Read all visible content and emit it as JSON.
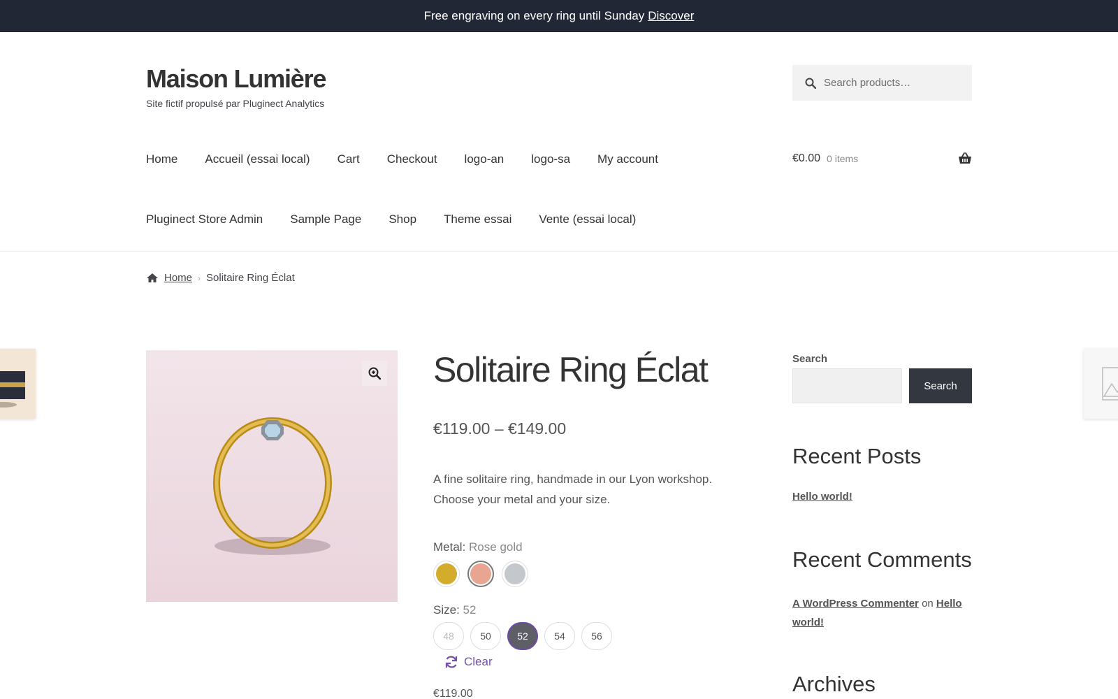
{
  "promo": {
    "text": "Free engraving on every ring until Sunday",
    "link": "Discover"
  },
  "site": {
    "title": "Maison Lumière",
    "tagline": "Site fictif propulsé par Pluginect Analytics"
  },
  "header_search": {
    "placeholder": "Search products…"
  },
  "nav": {
    "row1": [
      "Home",
      "Accueil (essai local)",
      "Cart",
      "Checkout",
      "logo-an",
      "logo-sa",
      "My account"
    ],
    "row2": [
      "Pluginect Store Admin",
      "Sample Page",
      "Shop",
      "Theme essai",
      "Vente (essai local)"
    ]
  },
  "cart": {
    "amount": "€0.00",
    "items": "0 items"
  },
  "breadcrumb": {
    "home": "Home",
    "current": "Solitaire Ring Éclat"
  },
  "product": {
    "title": "Solitaire Ring Éclat",
    "price_range": "€119.00 – €149.00",
    "description": "A fine solitaire ring, handmade in our Lyon workshop. Choose your metal and your size.",
    "metal_label": "Metal",
    "metal_value": "Rose gold",
    "metals": [
      {
        "name": "Gold",
        "color": "#d4ac2b"
      },
      {
        "name": "Rose gold",
        "color": "#e8a592"
      },
      {
        "name": "Silver",
        "color": "#c4c7cc"
      }
    ],
    "size_label": "Size",
    "size_value": "52",
    "sizes": [
      "48",
      "50",
      "52",
      "54",
      "56"
    ],
    "clear_label": "Clear",
    "variation_price": "€119.00"
  },
  "sidebar": {
    "search_label": "Search",
    "search_button": "Search",
    "recent_posts_title": "Recent Posts",
    "recent_posts": [
      "Hello world!"
    ],
    "recent_comments_title": "Recent Comments",
    "comment": {
      "author": "A WordPress Commenter",
      "on": "on",
      "post": "Hello world!"
    },
    "archives_title": "Archives"
  },
  "colors": {
    "topbar": "#222735",
    "accent": "#7552a8",
    "button": "#333740"
  }
}
